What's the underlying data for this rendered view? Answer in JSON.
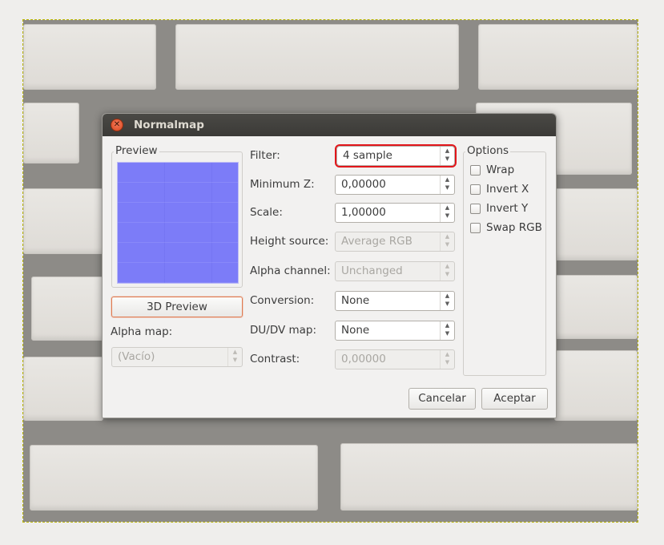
{
  "dialog": {
    "title": "Normalmap",
    "preview_frame": "Preview",
    "preview_button": "3D Preview",
    "alpha_map_label": "Alpha map:",
    "alpha_map_value": "(Vacío)",
    "fields": {
      "filter": {
        "label": "Filter:",
        "value": "4 sample"
      },
      "min_z": {
        "label": "Minimum Z:",
        "value": "0,00000"
      },
      "scale": {
        "label": "Scale:",
        "value": "1,00000"
      },
      "height_source": {
        "label": "Height source:",
        "value": "Average RGB"
      },
      "alpha_channel": {
        "label": "Alpha channel:",
        "value": "Unchanged"
      },
      "conversion": {
        "label": "Conversion:",
        "value": "None"
      },
      "dudv_map": {
        "label": "DU/DV map:",
        "value": "None"
      },
      "contrast": {
        "label": "Contrast:",
        "value": "0,00000"
      }
    },
    "options": {
      "title": "Options",
      "wrap": "Wrap",
      "invert_x": "Invert X",
      "invert_y": "Invert Y",
      "swap_rgb": "Swap RGB"
    },
    "buttons": {
      "cancel": "Cancelar",
      "accept": "Aceptar"
    }
  },
  "colors": {
    "accent_highlight": "#e2161b",
    "preview_normal": "#7c7cf8",
    "titlebar": "#3b3a37"
  }
}
